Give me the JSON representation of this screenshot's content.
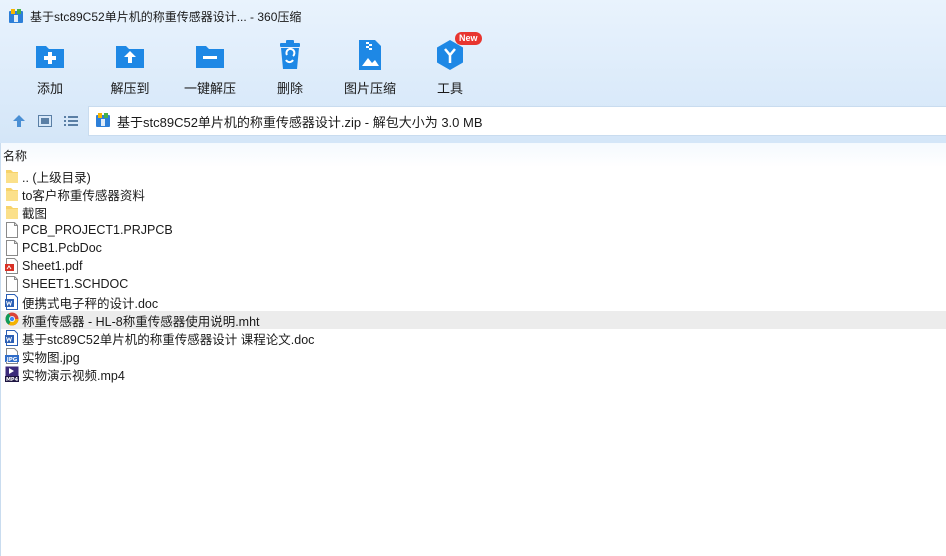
{
  "window": {
    "title": "基于stc89C52单片机的称重传感器设计... - 360压缩"
  },
  "toolbar": {
    "items": [
      {
        "label": "添加",
        "icon": "add-icon"
      },
      {
        "label": "解压到",
        "icon": "extract-to-icon"
      },
      {
        "label": "一键解压",
        "icon": "one-click-extract-icon"
      },
      {
        "label": "删除",
        "icon": "delete-icon"
      },
      {
        "label": "图片压缩",
        "icon": "image-compress-icon"
      },
      {
        "label": "工具",
        "icon": "tools-icon",
        "badge": "New"
      }
    ]
  },
  "navbar": {
    "address": "基于stc89C52单片机的称重传感器设计.zip - 解包大小为 3.0 MB"
  },
  "list": {
    "column_name": "名称",
    "rows": [
      {
        "name": ".. (上级目录)",
        "icon": "folder-icon"
      },
      {
        "name": "to客户称重传感器资料",
        "icon": "folder-icon"
      },
      {
        "name": "截图",
        "icon": "folder-icon"
      },
      {
        "name": "PCB_PROJECT1.PRJPCB",
        "icon": "file-icon"
      },
      {
        "name": "PCB1.PcbDoc",
        "icon": "file-icon"
      },
      {
        "name": "Sheet1.pdf",
        "icon": "pdf-icon"
      },
      {
        "name": "SHEET1.SCHDOC",
        "icon": "file-icon"
      },
      {
        "name": "便携式电子秤的设计.doc",
        "icon": "word-icon"
      },
      {
        "name": "称重传感器 - HL-8称重传感器使用说明.mht",
        "icon": "chrome-icon",
        "hovered": true
      },
      {
        "name": "基于stc89C52单片机的称重传感器设计 课程论文.doc",
        "icon": "word-icon"
      },
      {
        "name": "实物图.jpg",
        "icon": "jpg-icon"
      },
      {
        "name": "实物演示视频.mp4",
        "icon": "mp4-icon"
      }
    ]
  },
  "colors": {
    "accent": "#1e88e5",
    "folder": "#f7d36a",
    "badge": "#e8352f"
  }
}
